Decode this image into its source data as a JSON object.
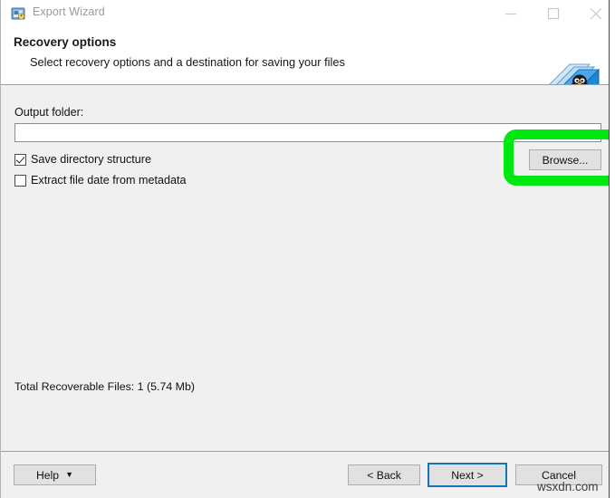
{
  "window": {
    "title": "Export Wizard",
    "icon": "export-wizard-icon",
    "controls": {
      "minimize": "minimize-icon",
      "maximize": "maximize-icon",
      "close": "close-icon"
    }
  },
  "header": {
    "title": "Recovery options",
    "subtitle": "Select recovery options and a destination for saving your files",
    "logo": "linux-penguin-logo"
  },
  "main": {
    "output_folder_label": "Output folder:",
    "output_folder_value": "",
    "output_folder_placeholder": "",
    "browse_label": "Browse...",
    "checkboxes": [
      {
        "label": "Save directory structure",
        "checked": true
      },
      {
        "label": "Extract file date from metadata",
        "checked": false
      }
    ],
    "total_recoverable": "Total Recoverable Files: 1 (5.74 Mb)"
  },
  "footer": {
    "help_label": "Help",
    "help_caret": "▼",
    "back_label": "< Back",
    "next_label": "Next >",
    "cancel_label": "Cancel"
  },
  "annotation": {
    "highlight_color": "#00e810",
    "target": "browse-button"
  },
  "watermark": {
    "text": "wsxdn.com"
  },
  "colors": {
    "window_background": "#f0f0f0",
    "header_background": "#ffffff",
    "focus_border": "#1375b4",
    "title_text": "#9a9a9a"
  }
}
